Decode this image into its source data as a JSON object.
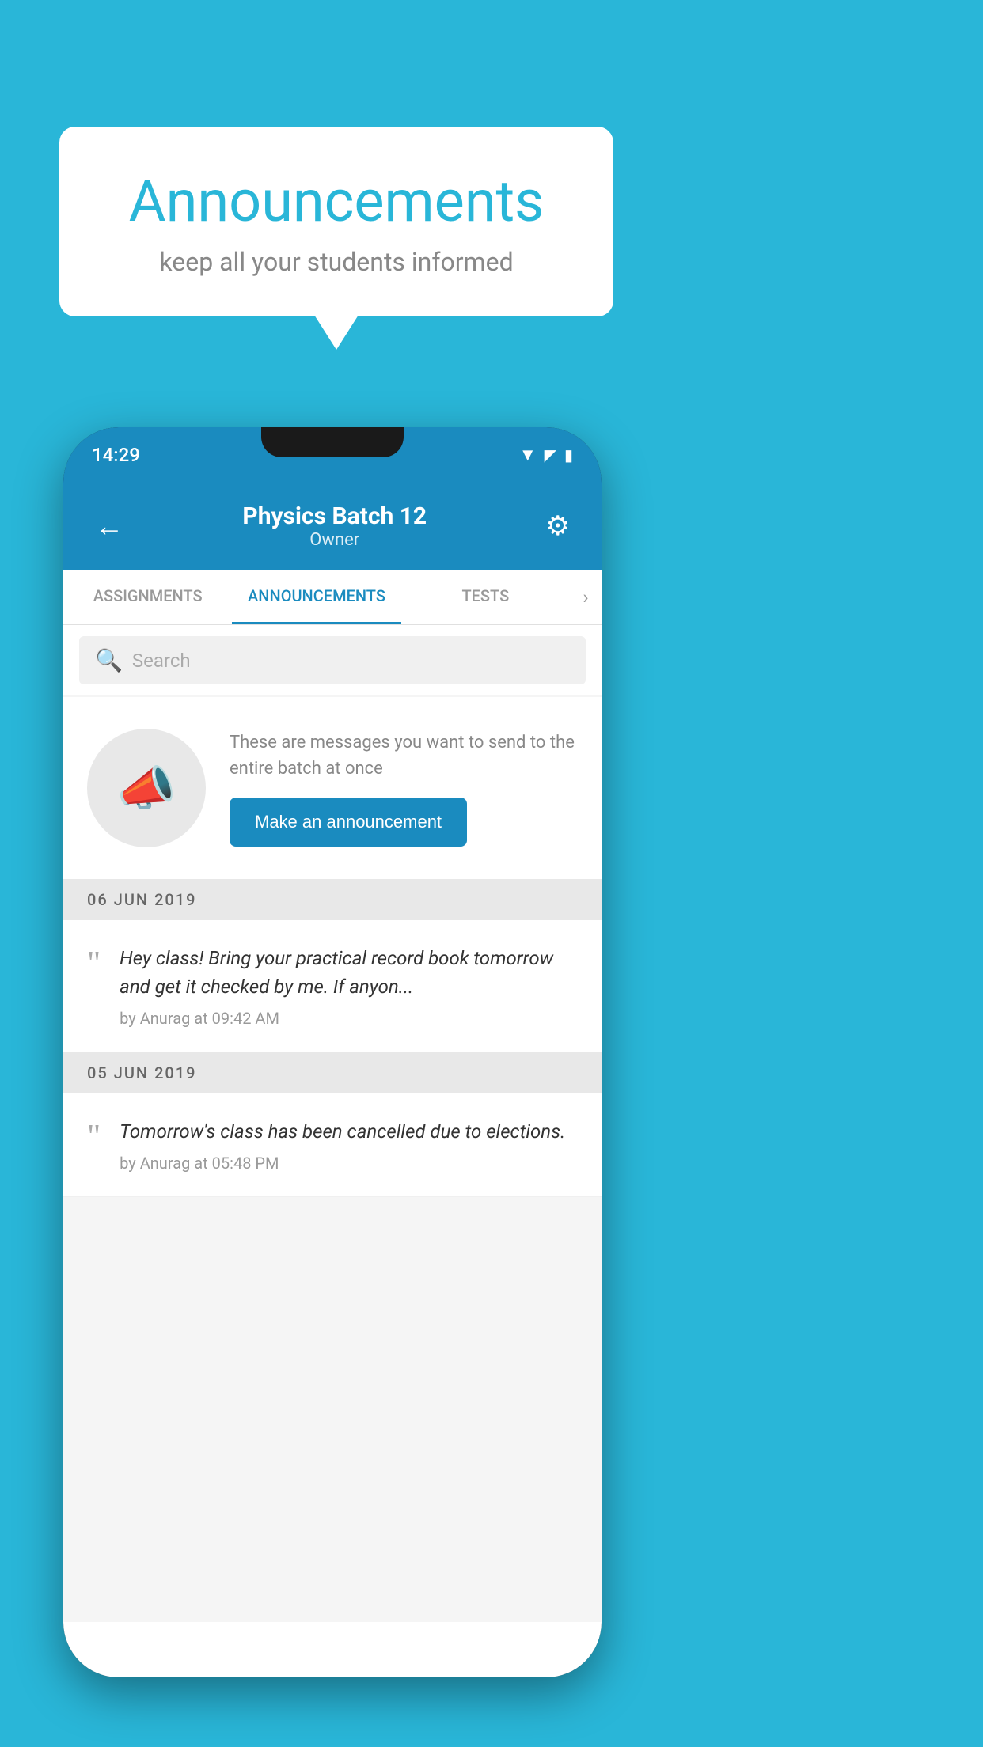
{
  "background_color": "#29b6d8",
  "speech_bubble": {
    "title": "Announcements",
    "subtitle": "keep all your students informed"
  },
  "phone": {
    "status_bar": {
      "time": "14:29"
    },
    "app_bar": {
      "title": "Physics Batch 12",
      "subtitle": "Owner",
      "back_label": "←",
      "settings_label": "⚙"
    },
    "tabs": [
      {
        "label": "ASSIGNMENTS",
        "active": false
      },
      {
        "label": "ANNOUNCEMENTS",
        "active": true
      },
      {
        "label": "TESTS",
        "active": false
      }
    ],
    "more_tab": "›",
    "search": {
      "placeholder": "Search"
    },
    "announcement_prompt": {
      "description": "These are messages you want to send to the entire batch at once",
      "button_label": "Make an announcement"
    },
    "date_sections": [
      {
        "date": "06  JUN  2019",
        "announcements": [
          {
            "text": "Hey class! Bring your practical record book tomorrow and get it checked by me. If anyon...",
            "meta": "by Anurag at 09:42 AM"
          }
        ]
      },
      {
        "date": "05  JUN  2019",
        "announcements": [
          {
            "text": "Tomorrow's class has been cancelled due to elections.",
            "meta": "by Anurag at 05:48 PM"
          }
        ]
      }
    ]
  }
}
